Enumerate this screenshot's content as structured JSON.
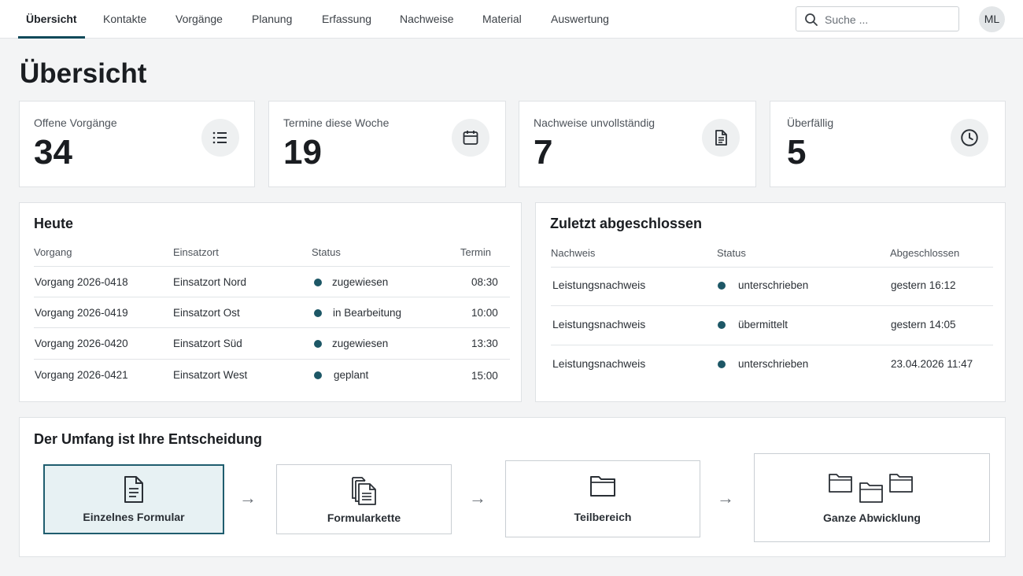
{
  "nav": {
    "items": [
      "Übersicht",
      "Kontakte",
      "Vorgänge",
      "Planung",
      "Erfassung",
      "Nachweise",
      "Material",
      "Auswertung"
    ],
    "search_placeholder": "Suche ...",
    "avatar_initials": "ML"
  },
  "page": {
    "title": "Übersicht"
  },
  "stats": [
    {
      "label": "Offene Vorgänge",
      "value": "34",
      "icon": "list-icon"
    },
    {
      "label": "Termine diese Woche",
      "value": "19",
      "icon": "calendar-icon"
    },
    {
      "label": "Nachweise unvollständig",
      "value": "7",
      "icon": "document-icon"
    },
    {
      "label": "Überfällig",
      "value": "5",
      "icon": "clock-icon"
    }
  ],
  "today": {
    "title": "Heute",
    "headers": [
      "Vorgang",
      "Einsatzort",
      "Status",
      "Termin"
    ],
    "rows": [
      {
        "vorgang": "Vorgang 2026-0418",
        "ort": "Einsatzort Nord",
        "status": "zugewiesen",
        "termin": "08:30"
      },
      {
        "vorgang": "Vorgang 2026-0419",
        "ort": "Einsatzort Ost",
        "status": "in Bearbeitung",
        "termin": "10:00"
      },
      {
        "vorgang": "Vorgang 2026-0420",
        "ort": "Einsatzort Süd",
        "status": "zugewiesen",
        "termin": "13:30"
      },
      {
        "vorgang": "Vorgang 2026-0421",
        "ort": "Einsatzort West",
        "status": "geplant",
        "termin": "15:00"
      }
    ]
  },
  "recent": {
    "title": "Zuletzt abgeschlossen",
    "headers": [
      "Nachweis",
      "Status",
      "Abgeschlossen"
    ],
    "rows": [
      {
        "nachweis": "Leistungsnachweis",
        "status": "unterschrieben",
        "date": "gestern 16:12"
      },
      {
        "nachweis": "Leistungsnachweis",
        "status": "übermittelt",
        "date": "gestern 14:05"
      },
      {
        "nachweis": "Leistungsnachweis",
        "status": "unterschrieben",
        "date": "23.04.2026 11:47"
      }
    ]
  },
  "scope": {
    "title": "Der Umfang ist Ihre Entscheidung",
    "steps": [
      {
        "label": "Einzelnes Formular",
        "icon": "document-icon",
        "selected": true
      },
      {
        "label": "Formularkette",
        "icon": "document-stack-icon",
        "selected": false
      },
      {
        "label": "Teilbereich",
        "icon": "folder-icon",
        "selected": false
      },
      {
        "label": "Ganze Abwicklung",
        "icon": "folder-group-icon",
        "selected": false
      }
    ],
    "arrow_glyph": "→"
  },
  "colors": {
    "accent": "#0f4a5a",
    "status_dot": "#1d5766",
    "selected_bg": "#e7f1f3"
  }
}
